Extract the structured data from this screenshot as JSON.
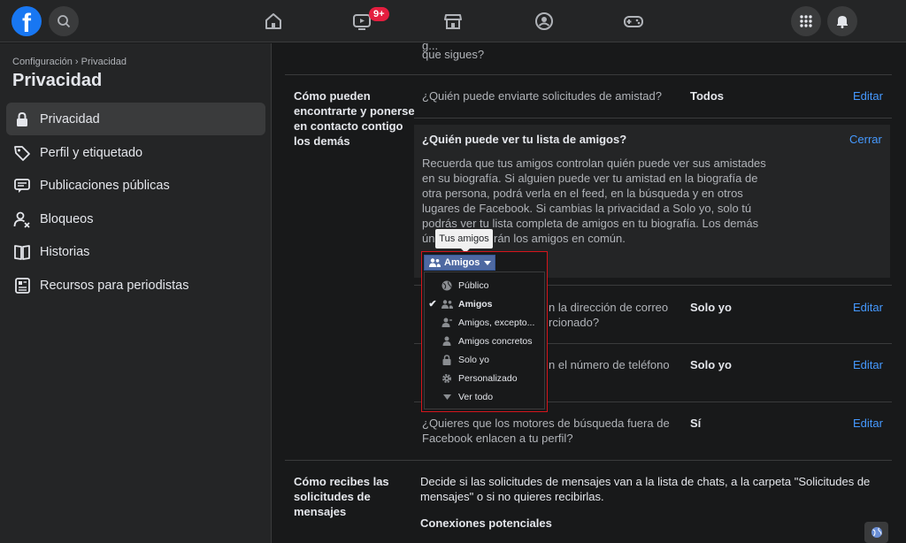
{
  "topbar": {
    "logo": "f",
    "nav_icons": [
      "home-icon",
      "watch-icon",
      "marketplace-icon",
      "groups-icon",
      "gaming-icon"
    ],
    "watch_badge": "9+"
  },
  "sidebar": {
    "breadcrumb": "Configuración › Privacidad",
    "title": "Privacidad",
    "items": [
      {
        "label": "Privacidad",
        "icon": "lock-icon",
        "active": true
      },
      {
        "label": "Perfil y etiquetado",
        "icon": "tag-icon"
      },
      {
        "label": "Publicaciones públicas",
        "icon": "public-posts-icon"
      },
      {
        "label": "Bloqueos",
        "icon": "blocking-icon"
      },
      {
        "label": "Historias",
        "icon": "book-icon"
      },
      {
        "label": "Recursos para periodistas",
        "icon": "newspaper-icon"
      }
    ]
  },
  "main": {
    "top_text_line1": "g...",
    "top_text_line2": "que sigues?",
    "section1_title": "Cómo pueden encontrarte y ponerse en contacto contigo los demás",
    "row1": {
      "question": "¿Quién puede enviarte solicitudes de amistad?",
      "value": "Todos",
      "action": "Editar"
    },
    "expanded": {
      "question": "¿Quién puede ver tu lista de amigos?",
      "action": "Cerrar",
      "description": "Recuerda que tus amigos controlan quién puede ver sus amistades en su biografía. Si alguien puede ver tu amistad en la biografía de otra persona, podrá verla en el feed, en la búsqueda y en otros lugares de Facebook. Si cambias la privacidad a Solo yo, solo tú podrás ver tu lista completa de amigos en tu biografía. Los demás",
      "description_end_a": "ún",
      "description_end_b": "rán los amigos en común."
    },
    "row3": {
      "question_a": "n la dirección de correo",
      "question_b": "rcionado?",
      "value": "Solo yo",
      "action": "Editar"
    },
    "row4": {
      "question": "n el número de teléfono",
      "value": "Solo yo",
      "action": "Editar"
    },
    "row5": {
      "question": "¿Quieres que los motores de búsqueda fuera de Facebook enlacen a tu perfil?",
      "value": "Sí",
      "action": "Editar"
    },
    "section2_title": "Cómo recibes las solicitudes de mensajes",
    "section2_text": "Decide si las solicitudes de mensajes van a la lista de chats, a la carpeta \"Solicitudes de mensajes\" o si no quieres recibirlas.",
    "section2_sub": "Conexiones potenciales"
  },
  "audience_selector": {
    "tooltip": "Tus amigos",
    "button_label": "Amigos",
    "options": [
      {
        "label": "Público",
        "icon": "globe-icon",
        "checked": false
      },
      {
        "label": "Amigos",
        "icon": "friends-icon",
        "checked": true
      },
      {
        "label": "Amigos, excepto...",
        "icon": "friends-except-icon",
        "checked": false
      },
      {
        "label": "Amigos concretos",
        "icon": "specific-friends-icon",
        "checked": false
      },
      {
        "label": "Solo yo",
        "icon": "lock-icon",
        "checked": false
      },
      {
        "label": "Personalizado",
        "icon": "gear-icon",
        "checked": false
      },
      {
        "label": "Ver todo",
        "icon": "chevron-down-icon",
        "checked": false
      }
    ]
  },
  "colors": {
    "accent": "#4599ff",
    "brand": "#1877f2",
    "highlight": "#d4151b"
  }
}
